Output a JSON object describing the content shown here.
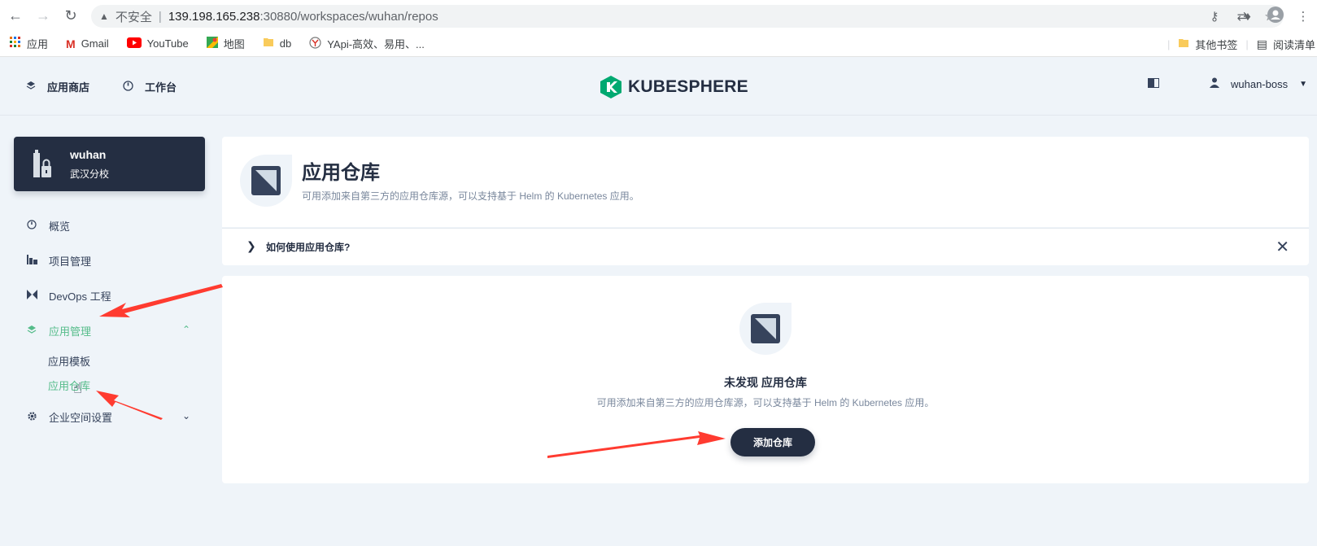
{
  "browser": {
    "url_warning": "不安全",
    "url_separator": "|",
    "url_host": "139.198.165.238",
    "url_path": ":30880/workspaces/wuhan/repos"
  },
  "bookmarks": {
    "items": [
      "应用",
      "Gmail",
      "YouTube",
      "地图",
      "db",
      "YApi-高效、易用、..."
    ],
    "other": "其他书签",
    "reading_list": "阅读清单"
  },
  "header": {
    "app_store": "应用商店",
    "workbench": "工作台",
    "logo": "KUBESPHERE",
    "user": "wuhan-boss"
  },
  "workspace": {
    "name": "wuhan",
    "desc": "武汉分校"
  },
  "sidebar": {
    "overview": "概览",
    "projects": "项目管理",
    "devops": "DevOps 工程",
    "app_mgmt": "应用管理",
    "app_templates": "应用模板",
    "app_repos": "应用仓库",
    "ws_settings": "企业空间设置"
  },
  "hero": {
    "title": "应用仓库",
    "desc": "可用添加来自第三方的应用仓库源，可以支持基于 Helm 的 Kubernetes 应用。"
  },
  "howto": {
    "text": "如何使用应用仓库?"
  },
  "empty": {
    "title": "未发现 应用仓库",
    "desc": "可用添加来自第三方的应用仓库源，可以支持基于 Helm 的 Kubernetes 应用。",
    "button": "添加仓库"
  },
  "colors": {
    "accent": "#55bc8a",
    "dark": "#242e42",
    "annotation": "#ff3b30"
  }
}
